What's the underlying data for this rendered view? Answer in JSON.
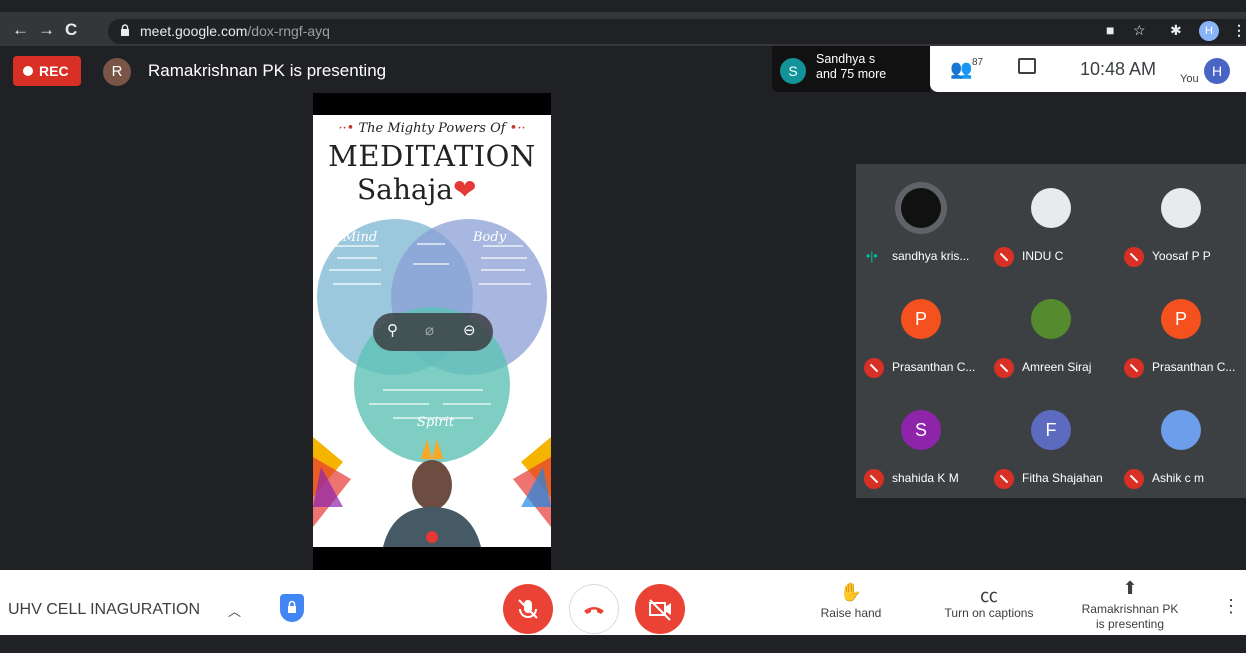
{
  "browser": {
    "url_host": "meet.google.com",
    "url_path": "/dox-rngf-ayq",
    "profile_initial": "H",
    "nav": {
      "back": "←",
      "forward": "→",
      "reload": "C"
    }
  },
  "top": {
    "rec_label": "REC",
    "presenter_initial": "R",
    "presenting_text": "Ramakrishnan PK is presenting",
    "active_speaker_initial": "S",
    "active_speaker_line1": "Sandhya s",
    "active_speaker_line2": "and 75 more",
    "participant_count": "87",
    "time": "10:48 AM",
    "you_label": "You",
    "you_initial": "H"
  },
  "slide": {
    "tagline": "The Mighty Powers Of",
    "title": "MEDITATION",
    "subtitle": "Sahaja",
    "circles": {
      "mind": "Mind",
      "body": "Body",
      "spirit": "Spirit"
    }
  },
  "participants": [
    {
      "name": "sandhya kris...",
      "initial": "",
      "color": "#111111",
      "speaking": true
    },
    {
      "name": "INDU C",
      "initial": "",
      "color": "#e8eaed",
      "speaking": false
    },
    {
      "name": "Yoosaf P P",
      "initial": "",
      "color": "#e8eaed",
      "speaking": false
    },
    {
      "name": "Prasanthan C...",
      "initial": "P",
      "color": "#f4511e",
      "speaking": false
    },
    {
      "name": "Amreen Siraj",
      "initial": "",
      "color": "#558b2f",
      "speaking": false
    },
    {
      "name": "Prasanthan C...",
      "initial": "P",
      "color": "#f4511e",
      "speaking": false
    },
    {
      "name": "shahida K M",
      "initial": "S",
      "color": "#8e24aa",
      "speaking": false
    },
    {
      "name": "Fitha Shajahan",
      "initial": "F",
      "color": "#5c6bc0",
      "speaking": false
    },
    {
      "name": "Ashik c m",
      "initial": "",
      "color": "#6d9eeb",
      "speaking": false
    }
  ],
  "bottom": {
    "meeting_name": "UHV CELL INAGURATION",
    "raise_hand": "Raise hand",
    "captions": "Turn on captions",
    "presenting_line1": "Ramakrishnan PK",
    "presenting_line2": "is presenting"
  }
}
